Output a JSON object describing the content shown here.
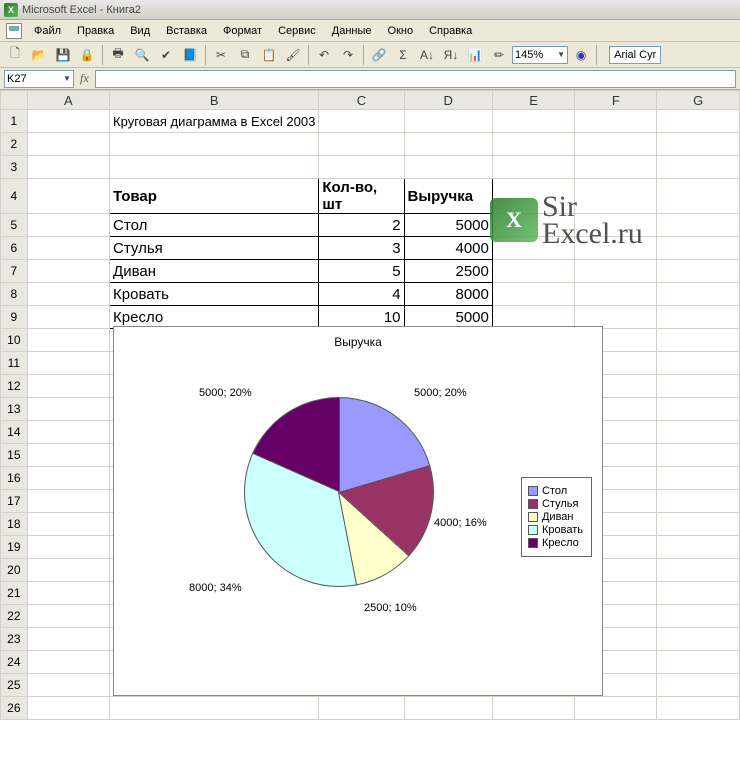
{
  "titlebar": {
    "app": "Microsoft Excel",
    "doc": "Книга2"
  },
  "menubar": [
    "Файл",
    "Правка",
    "Вид",
    "Вставка",
    "Формат",
    "Сервис",
    "Данные",
    "Окно",
    "Справка"
  ],
  "toolbar": {
    "zoom": "145%",
    "font": "Arial Cyr"
  },
  "namebox": "K27",
  "columns": [
    "A",
    "B",
    "C",
    "D",
    "E",
    "F",
    "G"
  ],
  "rows": [
    "1",
    "2",
    "3",
    "4",
    "5",
    "6",
    "7",
    "8",
    "9",
    "10",
    "11",
    "12",
    "13",
    "14",
    "15",
    "16",
    "17",
    "18",
    "19",
    "20",
    "21",
    "22",
    "23",
    "24",
    "25",
    "26"
  ],
  "title_cell": "Круговая диаграмма в Excel 2003",
  "table": {
    "headers": [
      "Товар",
      "Кол-во, шт",
      "Выручка"
    ],
    "rows": [
      {
        "name": "Стол",
        "qty": 2,
        "rev": 5000
      },
      {
        "name": "Стулья",
        "qty": 3,
        "rev": 4000
      },
      {
        "name": "Диван",
        "qty": 5,
        "rev": 2500
      },
      {
        "name": "Кровать",
        "qty": 4,
        "rev": 8000
      },
      {
        "name": "Кресло",
        "qty": 10,
        "rev": 5000
      }
    ]
  },
  "watermark": {
    "line1": "Sir",
    "line2": "Excel.ru"
  },
  "chart_data": {
    "type": "pie",
    "title": "Выручка",
    "categories": [
      "Стол",
      "Стулья",
      "Диван",
      "Кровать",
      "Кресло"
    ],
    "values": [
      5000,
      4000,
      2500,
      8000,
      5000
    ],
    "percents": [
      20,
      16,
      10,
      34,
      20
    ],
    "colors": [
      "#9999ff",
      "#993366",
      "#ffffcc",
      "#ccffff",
      "#660066"
    ],
    "labels": [
      "5000; 20%",
      "4000; 16%",
      "2500; 10%",
      "8000; 34%",
      "5000; 20%"
    ]
  }
}
